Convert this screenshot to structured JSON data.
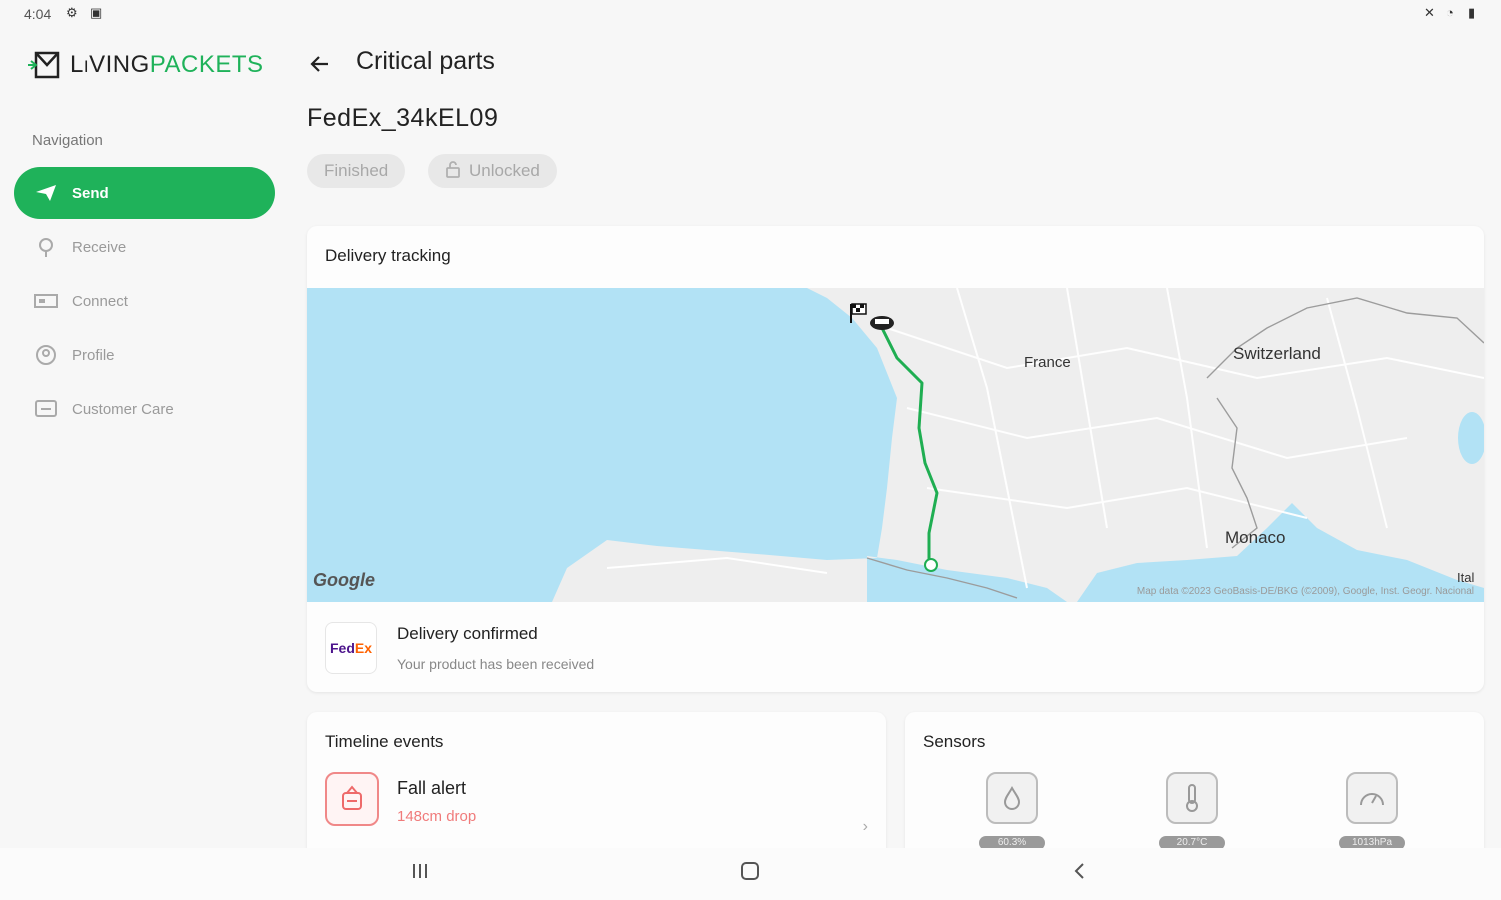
{
  "status_bar": {
    "time": "4:04",
    "left_icons": [
      "gear-icon",
      "image-icon"
    ],
    "right_icons": [
      "mute-icon",
      "wifi-icon",
      "battery-icon"
    ]
  },
  "app": {
    "brand_part1": "LiVING",
    "brand_part2": "PACKETS",
    "accent_color": "#1fb25a"
  },
  "sidebar": {
    "heading": "Navigation",
    "items": [
      {
        "label": "Send",
        "icon": "send-icon",
        "active": true
      },
      {
        "label": "Receive",
        "icon": "receive-icon",
        "active": false
      },
      {
        "label": "Connect",
        "icon": "connect-icon",
        "active": false
      },
      {
        "label": "Profile",
        "icon": "profile-icon",
        "active": false
      },
      {
        "label": "Customer Care",
        "icon": "chat-icon",
        "active": false
      }
    ]
  },
  "header": {
    "title": "Critical parts",
    "device_name": "FedEx_34kEL09",
    "chips": [
      "Finished",
      "Unlocked"
    ]
  },
  "delivery_card": {
    "title": "Delivery tracking",
    "map": {
      "labels": [
        "France",
        "Switzerland",
        "Monaco",
        "Ital"
      ],
      "google": "Google",
      "attribution": "Map data ©2023 GeoBasis-DE/BKG (©2009), Google, Inst. Geogr. Nacional"
    },
    "carrier": {
      "logo_fed": "Fed",
      "logo_ex": "Ex"
    },
    "status": "Delivery confirmed",
    "status_sub": "Your product has been received"
  },
  "timeline_card": {
    "title": "Timeline events",
    "event_title": "Fall alert",
    "event_sub": "148cm drop"
  },
  "sensors_card": {
    "title": "Sensors",
    "items": [
      {
        "icon": "humidity-icon",
        "value": "60.3%"
      },
      {
        "icon": "thermometer-icon",
        "value": "20.7°C"
      },
      {
        "icon": "pressure-icon",
        "value": "1013hPa"
      }
    ]
  }
}
